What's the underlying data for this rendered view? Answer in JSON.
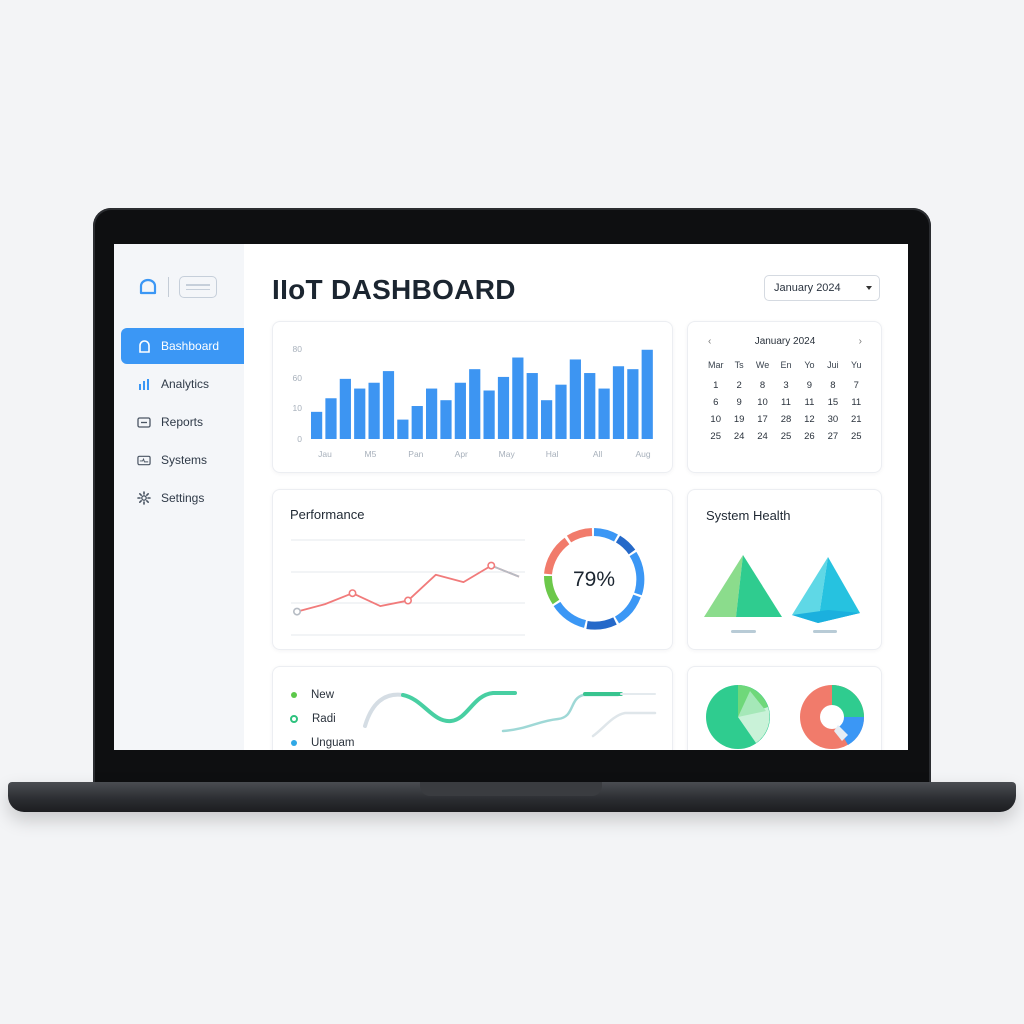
{
  "app": {
    "title": "IIoT DASHBOARD",
    "date_select": "January 2024"
  },
  "sidebar": {
    "items": [
      {
        "label": "Bashboard",
        "icon": "home-icon",
        "active": true
      },
      {
        "label": "Analytics",
        "icon": "bar-chart-icon",
        "active": false
      },
      {
        "label": "Reports",
        "icon": "report-icon",
        "active": false
      },
      {
        "label": "Systems",
        "icon": "system-icon",
        "active": false
      },
      {
        "label": "Settings",
        "icon": "gear-icon",
        "active": false
      }
    ]
  },
  "calendar": {
    "month": "January 2024",
    "days_of_week": [
      "Mar",
      "Ts",
      "We",
      "En",
      "Yo",
      "Jui",
      "Yu"
    ],
    "rows": [
      [
        "1",
        "2",
        "8",
        "3",
        "9",
        "8",
        "7"
      ],
      [
        "6",
        "9",
        "10",
        "11",
        "11",
        "15",
        "11"
      ],
      [
        "10",
        "19",
        "17",
        "28",
        "12",
        "30",
        "21"
      ],
      [
        "25",
        "24",
        "24",
        "25",
        "26",
        "27",
        "25"
      ]
    ]
  },
  "performance": {
    "title": "Performance",
    "gauge_label": "79%",
    "gauge_value": 79
  },
  "system_health": {
    "title": "System Health"
  },
  "legend": {
    "items": [
      {
        "label": "New",
        "color": "#5cc84a"
      },
      {
        "label": "Radi",
        "color": "#2ec27e"
      },
      {
        "label": "Unguam",
        "color": "#2fa8e6"
      }
    ]
  },
  "colors": {
    "accent": "#3b97f5",
    "bar": "#3d95f2",
    "line_red": "#f17b7b",
    "green": "#2ec27e",
    "teal": "#3fd1c4"
  },
  "chart_data": [
    {
      "type": "bar",
      "y_ticks": [
        "80",
        "60",
        "10",
        "0"
      ],
      "x_ticks": [
        "Jau",
        "M5",
        "Pan",
        "Apr",
        "May",
        "Hal",
        "All",
        "Aug"
      ],
      "values": [
        28,
        42,
        62,
        52,
        58,
        70,
        20,
        34,
        52,
        40,
        58,
        72,
        50,
        64,
        84,
        68,
        40,
        56,
        82,
        68,
        52,
        75,
        72,
        92
      ],
      "ylim": [
        0,
        100
      ]
    },
    {
      "type": "line",
      "values": [
        20,
        28,
        40,
        26,
        32,
        60,
        52,
        70,
        58
      ],
      "ylim": [
        0,
        100
      ]
    }
  ]
}
